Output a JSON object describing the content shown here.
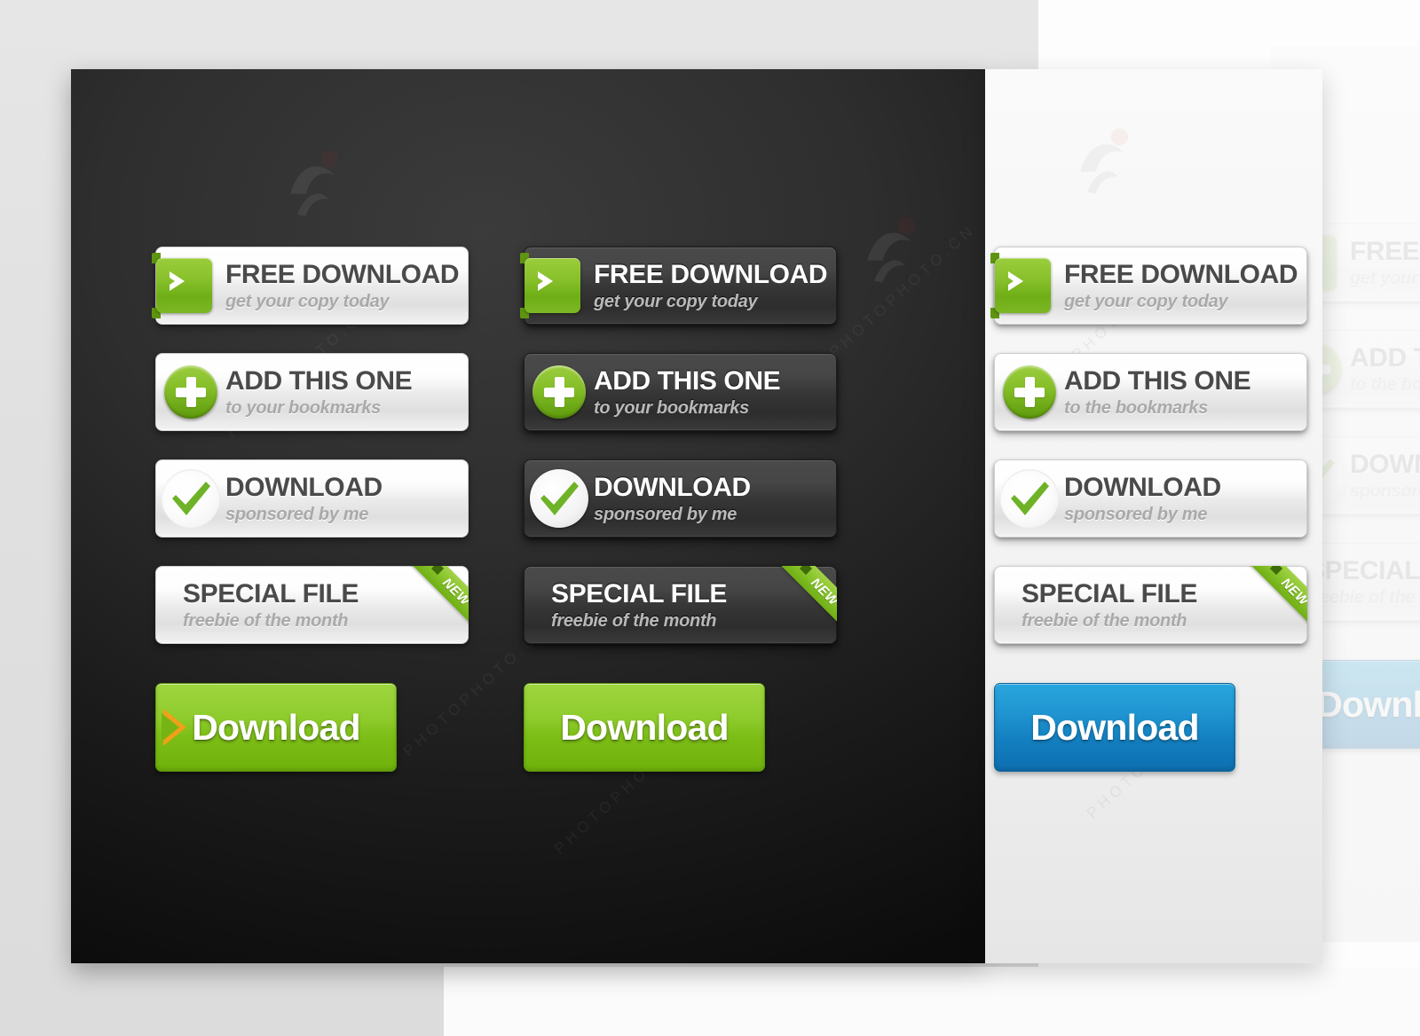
{
  "artboard": {
    "dark_panel_label": "dark-button-set",
    "light_panel_label": "light-button-set",
    "watermark_text": "PHOTOPHOTO.CN"
  },
  "colors": {
    "green_accent": "#7cb716",
    "green_light": "#9ccd3f",
    "blue_accent": "#137fc0",
    "dark_panel": "#2e2e2e",
    "light_panel": "#f3f3f3",
    "title_dark": "#4a4a4a",
    "sub_grey": "#a9a9a9"
  },
  "buttons": {
    "free_download": {
      "title": "FREE DOWNLOAD",
      "subtitle": "get your copy today",
      "icon": "chevron-right-tag-icon"
    },
    "add_this_one": {
      "title": "ADD THIS ONE",
      "subtitle": "to your bookmarks",
      "subtitle_alt": "to the bookmarks",
      "icon": "plus-circle-icon"
    },
    "download_sponsored": {
      "title": "DOWNLOAD",
      "subtitle": "sponsored by me",
      "icon": "check-mark-icon"
    },
    "special_file": {
      "title": "SPECIAL FILE",
      "subtitle": "freebie of the month",
      "badge": "NEW"
    },
    "download_plain": {
      "label": "Download"
    }
  },
  "columns": [
    {
      "id": "light-on-dark",
      "style": "light",
      "rows": [
        {
          "key": "free_download",
          "title": "FREE DOWNLOAD",
          "subtitle": "get your copy today"
        },
        {
          "key": "add_this_one",
          "title": "ADD THIS ONE",
          "subtitle": "to your bookmarks"
        },
        {
          "key": "download_sponsored",
          "title": "DOWNLOAD",
          "subtitle": "sponsored by me"
        },
        {
          "key": "special_file",
          "title": "SPECIAL FILE",
          "subtitle": "freebie of the month",
          "badge": "NEW"
        }
      ],
      "plain": {
        "label": "Download",
        "variant": "green",
        "has_arrow": true
      }
    },
    {
      "id": "dark-on-dark",
      "style": "dark",
      "rows": [
        {
          "key": "free_download",
          "title": "FREE DOWNLOAD",
          "subtitle": "get your copy today"
        },
        {
          "key": "add_this_one",
          "title": "ADD THIS ONE",
          "subtitle": "to your bookmarks"
        },
        {
          "key": "download_sponsored",
          "title": "DOWNLOAD",
          "subtitle": "sponsored by me"
        },
        {
          "key": "special_file",
          "title": "SPECIAL FILE",
          "subtitle": "freebie of the month",
          "badge": "NEW"
        }
      ],
      "plain": {
        "label": "Download",
        "variant": "green",
        "has_arrow": false
      }
    },
    {
      "id": "light-on-light",
      "style": "light",
      "rows": [
        {
          "key": "free_download",
          "title": "FREE DOWNLOAD",
          "subtitle": "get your copy today"
        },
        {
          "key": "add_this_one",
          "title": "ADD THIS ONE",
          "subtitle": "to the bookmarks"
        },
        {
          "key": "download_sponsored",
          "title": "DOWNLOAD",
          "subtitle": "sponsored by me"
        },
        {
          "key": "special_file",
          "title": "SPECIAL FILE",
          "subtitle": "freebie of the month",
          "badge": "NEW"
        }
      ],
      "plain": {
        "label": "Download",
        "variant": "blue",
        "has_arrow": false
      }
    }
  ]
}
